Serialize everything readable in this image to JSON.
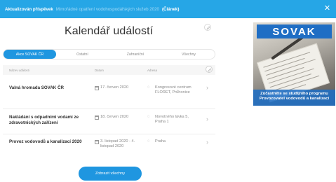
{
  "notice": {
    "bold": "Aktualizován příspěvek",
    "faint": "Mimořádné opatření vodohospodářských služeb 2020",
    "link": "(Článek)",
    "close_icon": "close-icon"
  },
  "calendar": {
    "title": "Kalendář událostí",
    "edit_icon": "pencil-icon",
    "tabs": [
      "Akce SOVAK ČR",
      "Ostatní",
      "Zahraniční",
      "Všechny"
    ],
    "active_tab": 0,
    "columns": [
      "Název události",
      "Datum",
      "Adresa"
    ],
    "events": [
      {
        "name": "Valná hromada SOVAK ČR",
        "date": "17. červen 2020",
        "place": "Kongresové centrum FLORET, Průhonice"
      },
      {
        "name": "Nakládání s odpadními vodami ze zdravotnických zařízení",
        "date": "18. červen 2020",
        "place": "Novotného lávka 5, Praha 1"
      },
      {
        "name": "Provoz vodovodů a kanalizací 2020",
        "date": "3. listopad 2020 - 4. listopad 2020",
        "place": "Praha"
      }
    ],
    "show_all": "Zobrazit všechny"
  },
  "ad": {
    "logo": "SOVAK",
    "text": "Zúčastněte se studijního programu Provozovatel vodovodů a kanalizací",
    "accent": "#1f6ec4"
  },
  "colors": {
    "accent": "#1f96e0",
    "notice_bg": "#26a6e6"
  }
}
